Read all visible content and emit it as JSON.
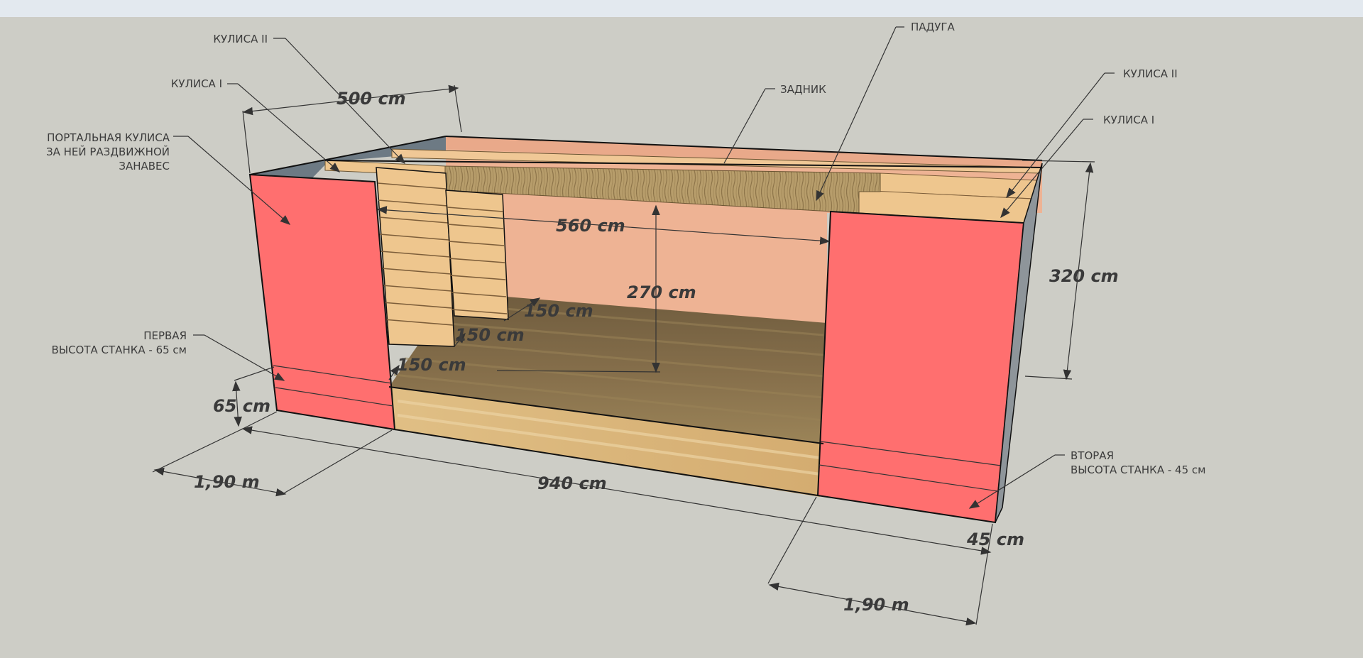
{
  "colors": {
    "background": "#cdcdc6",
    "portal_red": "#ff6f6f",
    "backdrop_peach": "#eeb394",
    "wing_wood": "#eec68e",
    "floor_dark": "#7c6744",
    "floor_light": "#d9b57a",
    "roof_slate": "#6d7a84"
  },
  "icons": {
    "arrow": "arrowhead-icon"
  },
  "labels": {
    "kulisa2_left": "КУЛИСА II",
    "kulisa1_left": "КУЛИСА I",
    "portal_line1": "ПОРТАЛЬНАЯ КУЛИСА",
    "portal_line2": "ЗА НЕЙ РАЗДВИЖНОЙ",
    "portal_line3": "ЗАНАВЕС",
    "padug": "ПАДУГА",
    "zadnik": "ЗАДНИК",
    "kulisa2_right": "КУЛИСА II",
    "kulisa1_right": "КУЛИСА I",
    "first_line1": "ПЕРВАЯ",
    "first_line2": "ВЫСОТА СТАНКА - 65 см",
    "second_line1": "ВТОРАЯ",
    "second_line2": "ВЫСОТА СТАНКА - 45 см"
  },
  "dimensions": {
    "depth_top": "500 cm",
    "opening_width": "560 cm",
    "opening_height": "270 cm",
    "total_height": "320 cm",
    "wing_depth_1": "150 cm",
    "wing_depth_2": "150 cm",
    "wing_depth_3": "150 cm",
    "left_platform_height": "65 cm",
    "left_platform_width": "1,90 m",
    "total_width": "940 cm",
    "right_platform_height": "45 cm",
    "right_platform_width": "1,90 m"
  }
}
